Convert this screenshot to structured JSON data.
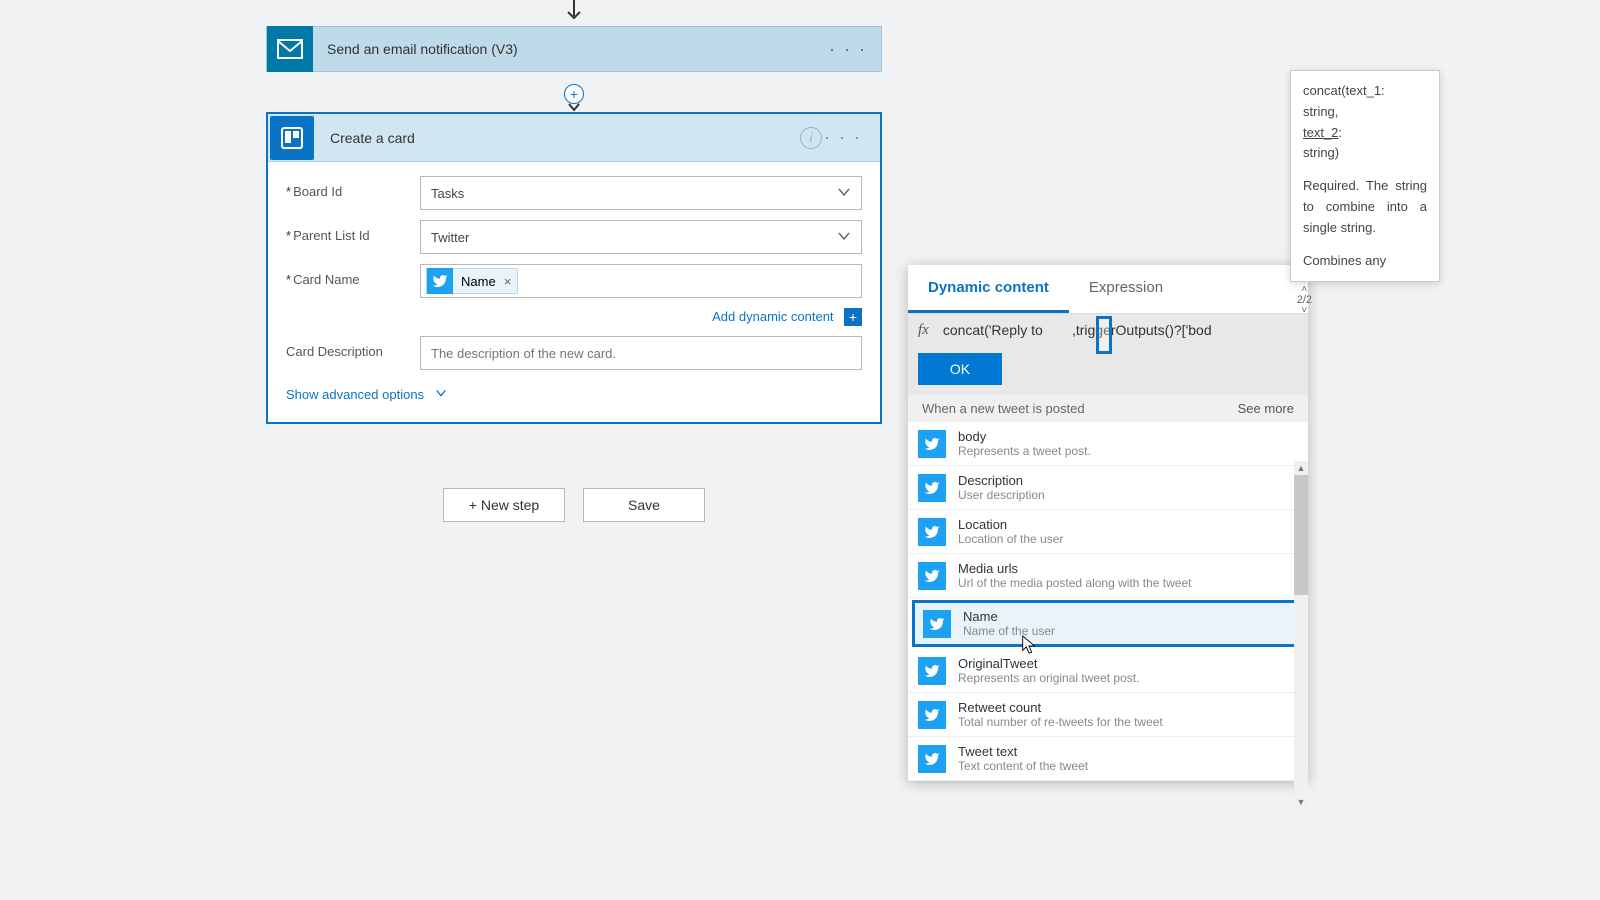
{
  "email_card": {
    "title": "Send an email notification (V3)"
  },
  "plus_circle": "+",
  "create_card": {
    "title": "Create a card",
    "fields": {
      "board_id": {
        "label": "Board Id",
        "value": "Tasks"
      },
      "parent_list_id": {
        "label": "Parent List Id",
        "value": "Twitter"
      },
      "card_name": {
        "label": "Card Name",
        "token": "Name"
      },
      "card_description": {
        "label": "Card Description",
        "placeholder": "The description of the new card."
      }
    },
    "add_dynamic": "Add dynamic content",
    "show_advanced": "Show advanced options"
  },
  "buttons": {
    "new_step": "+ New step",
    "save": "Save"
  },
  "dynamic_panel": {
    "tabs": {
      "dynamic": "Dynamic content",
      "expression": "Expression"
    },
    "nav_count": "2/2",
    "fx_prefix": "concat('Reply to ",
    "fx_suffix": ",triggerOutputs()?['bod",
    "ok": "OK",
    "section_title": "When a new tweet is posted",
    "see_more": "See more",
    "items": [
      {
        "title": "body",
        "desc": "Represents a tweet post."
      },
      {
        "title": "Description",
        "desc": "User description"
      },
      {
        "title": "Location",
        "desc": "Location of the user"
      },
      {
        "title": "Media urls",
        "desc": "Url of the media posted along with the tweet"
      },
      {
        "title": "Name",
        "desc": "Name of the user"
      },
      {
        "title": "OriginalTweet",
        "desc": "Represents an original tweet post."
      },
      {
        "title": "Retweet count",
        "desc": "Total number of re-tweets for the tweet"
      },
      {
        "title": "Tweet text",
        "desc": "Text content of the tweet"
      }
    ]
  },
  "tooltip": {
    "line1": "concat(text_1:",
    "line2": "string,",
    "line3": "text_2",
    "line3b": ":",
    "line4": "string)",
    "para1": "Required. The string to combine into a single string.",
    "para2": "Combines any"
  }
}
